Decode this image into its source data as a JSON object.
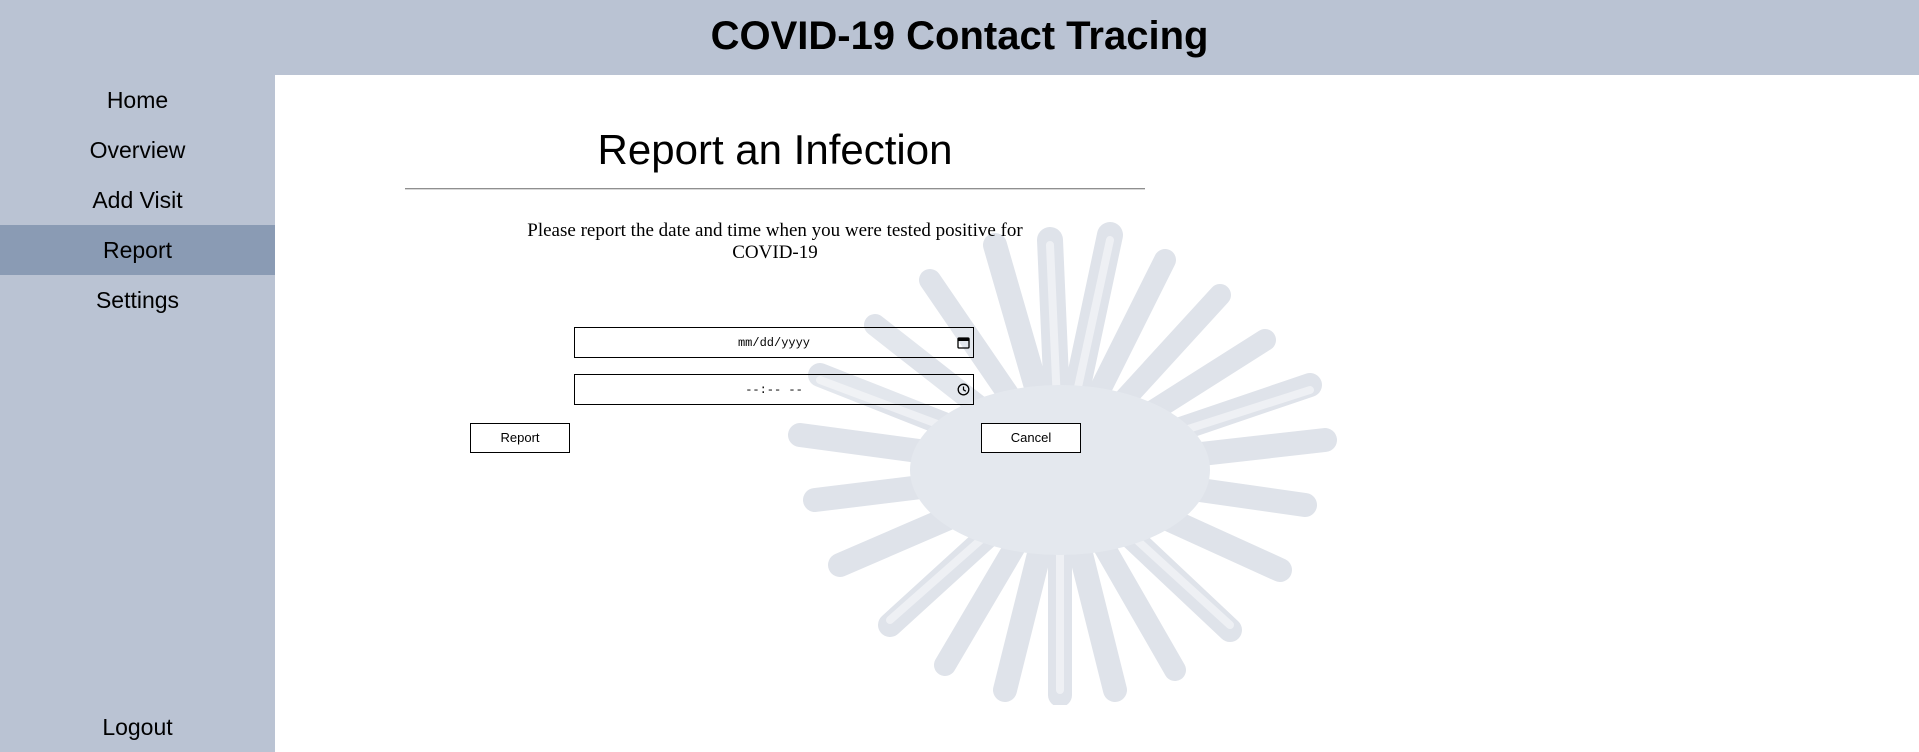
{
  "header": {
    "title": "COVID-19 Contact Tracing"
  },
  "sidebar": {
    "items": [
      {
        "label": "Home"
      },
      {
        "label": "Overview"
      },
      {
        "label": "Add Visit"
      },
      {
        "label": "Report",
        "active": true
      },
      {
        "label": "Settings"
      }
    ],
    "logout_label": "Logout",
    "active_color": "#8a9bb4",
    "background_color": "#bac3d3"
  },
  "main": {
    "title": "Report an Infection",
    "instructions": "Please report the date and time when you were tested positive for COVID-19",
    "date_field": {
      "placeholder": "mm/dd/yyyy",
      "icon": "calendar-icon"
    },
    "time_field": {
      "placeholder": "--:-- --",
      "icon": "clock-icon"
    },
    "report_button": "Report",
    "cancel_button": "Cancel",
    "background_image": "virus-illustration"
  }
}
